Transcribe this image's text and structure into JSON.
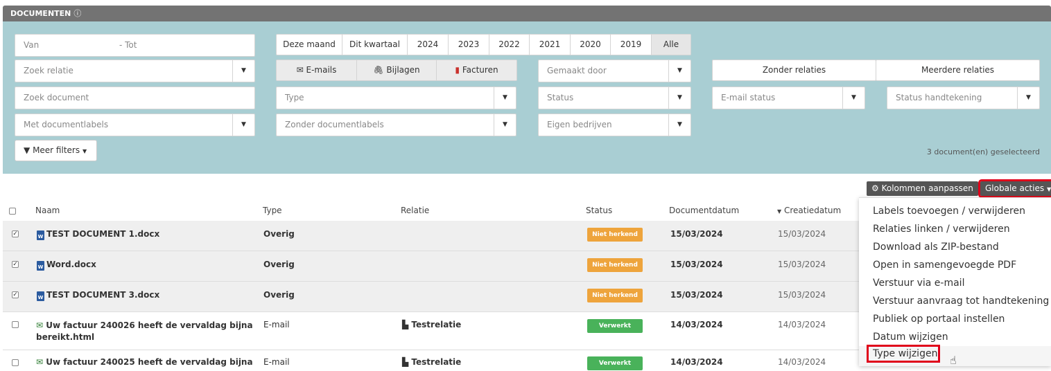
{
  "panel": {
    "title": "DOCUMENTEN",
    "help_icon": "question-circle-icon"
  },
  "filters": {
    "date_from": "Van",
    "date_sep": "- Tot",
    "periods": [
      "Deze maand",
      "Dit kwartaal",
      "2024",
      "2023",
      "2022",
      "2021",
      "2020",
      "2019",
      "Alle"
    ],
    "active_period": "Alle",
    "zoek_relatie": "Zoek relatie",
    "types": [
      "E-mails",
      "Bijlagen",
      "Facturen"
    ],
    "gemaakt_door": "Gemaakt door",
    "zonder_relaties": "Zonder relaties",
    "meerdere_relaties": "Meerdere relaties",
    "zoek_document": "Zoek document",
    "type": "Type",
    "status": "Status",
    "email_status": "E-mail status",
    "status_handtekening": "Status handtekening",
    "met_documentlabels": "Met documentlabels",
    "zonder_documentlabels": "Zonder documentlabels",
    "eigen_bedrijven": "Eigen bedrijven",
    "meer_filters": "Meer filters",
    "selected_count": "3 document(en) geselecteerd"
  },
  "toolbar": {
    "kolommen": "Kolommen aanpassen",
    "globale_acties": "Globale acties"
  },
  "columns": {
    "naam": "Naam",
    "type": "Type",
    "relatie": "Relatie",
    "status": "Status",
    "documentdatum": "Documentdatum",
    "creatiedatum": "Creatiedatum"
  },
  "rows": [
    {
      "checked": true,
      "icon": "word-file-icon",
      "name": "TEST DOCUMENT 1.docx",
      "name2": "",
      "type": "Overig",
      "relatie": "",
      "status": "Niet herkend",
      "status_color": "#eea43c",
      "docdate": "15/03/2024",
      "created": "15/03/2024"
    },
    {
      "checked": true,
      "icon": "word-file-icon",
      "name": "Word.docx",
      "name2": "",
      "type": "Overig",
      "relatie": "",
      "status": "Niet herkend",
      "status_color": "#eea43c",
      "docdate": "15/03/2024",
      "created": "15/03/2024"
    },
    {
      "checked": true,
      "icon": "word-file-icon",
      "name": "TEST DOCUMENT 3.docx",
      "name2": "",
      "type": "Overig",
      "relatie": "",
      "status": "Niet herkend",
      "status_color": "#eea43c",
      "docdate": "15/03/2024",
      "created": "15/03/2024"
    },
    {
      "checked": false,
      "icon": "email-check-icon",
      "name": "Uw factuur 240026 heeft de vervaldag bijna",
      "name2": "bereikt.html",
      "type": "E-mail",
      "relatie": "Testrelatie",
      "status": "Verwerkt",
      "status_color": "#49b25a",
      "docdate": "14/03/2024",
      "created": "14/03/2024"
    },
    {
      "checked": false,
      "icon": "email-check-icon",
      "name": "Uw factuur 240025 heeft de vervaldag bijna",
      "name2": "",
      "type": "E-mail",
      "relatie": "Testrelatie",
      "status": "Verwerkt",
      "status_color": "#49b25a",
      "docdate": "14/03/2024",
      "created": "14/03/2024"
    }
  ],
  "menu": [
    "Labels toevoegen / verwijderen",
    "Relaties linken / verwijderen",
    "Download als ZIP-bestand",
    "Open in samengevoegde PDF",
    "Verstuur via e-mail",
    "Verstuur aanvraag tot handtekening",
    "Publiek op portaal instellen",
    "Datum wijzigen",
    "Type wijzigen"
  ]
}
